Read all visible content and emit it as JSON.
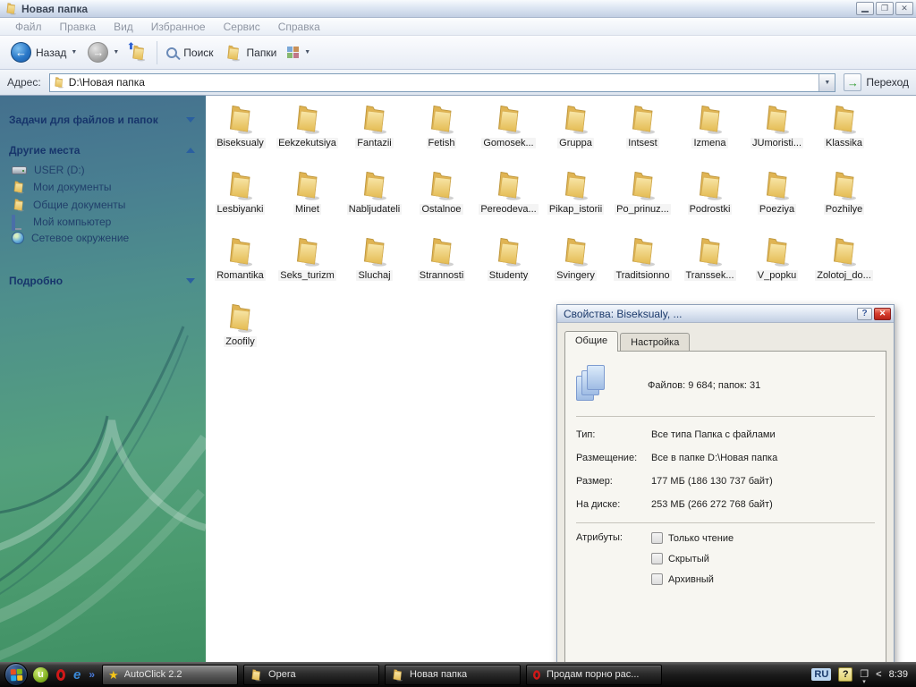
{
  "window": {
    "title": "Новая папка",
    "menu": [
      "Файл",
      "Правка",
      "Вид",
      "Избранное",
      "Сервис",
      "Справка"
    ],
    "toolbar": {
      "back_label": "Назад",
      "search_label": "Поиск",
      "folders_label": "Папки"
    },
    "address": {
      "label": "Адрес:",
      "value": "D:\\Новая папка",
      "go_label": "Переход"
    }
  },
  "sidebar": {
    "sections": [
      {
        "title": "Задачи для файлов и папок",
        "collapsed": true
      },
      {
        "title": "Другие места",
        "collapsed": false
      },
      {
        "title": "Подробно",
        "collapsed": true
      }
    ],
    "places": [
      {
        "label": "USER (D:)",
        "icon": "drive"
      },
      {
        "label": "Мои документы",
        "icon": "folder"
      },
      {
        "label": "Общие документы",
        "icon": "folder"
      },
      {
        "label": "Мой компьютер",
        "icon": "computer"
      },
      {
        "label": "Сетевое окружение",
        "icon": "network"
      }
    ]
  },
  "folders": [
    "Biseksualy",
    "Eekzekutsiya",
    "Fantazii",
    "Fetish",
    "Gomosek...",
    "Gruppa",
    "Intsest",
    "Izmena",
    "JUmoristi...",
    "Klassika",
    "Lesbiyanki",
    "Minet",
    "Nabljudateli",
    "Ostalnoe",
    "Pereodeva...",
    "Pikap_istorii",
    "Po_prinuz...",
    "Podrostki",
    "Poeziya",
    "Pozhilye",
    "Romantika",
    "Seks_turizm",
    "Sluchaj",
    "Strannosti",
    "Studenty",
    "Svingery",
    "Traditsionno",
    "Transsek...",
    "V_popku",
    "Zolotoj_do...",
    "Zoofily"
  ],
  "dialog": {
    "title": "Свойства: Biseksualy, ...",
    "tabs": [
      "Общие",
      "Настройка"
    ],
    "summary": "Файлов: 9 684; папок: 31",
    "rows": [
      {
        "label": "Тип:",
        "value": "Все типа Папка с файлами"
      },
      {
        "label": "Размещение:",
        "value": "Все в папке D:\\Новая папка"
      },
      {
        "label": "Размер:",
        "value": "177 МБ (186 130 737 байт)"
      },
      {
        "label": "На диске:",
        "value": "253 МБ (266 272 768 байт)"
      }
    ],
    "attributes": {
      "label": "Атрибуты:",
      "options": [
        {
          "label": "Только чтение",
          "checked": false
        },
        {
          "label": "Скрытый",
          "checked": false
        },
        {
          "label": "Архивный",
          "checked": false
        }
      ]
    }
  },
  "taskbar": {
    "buttons": [
      {
        "label": "AutoClick 2.2",
        "icon": "star",
        "active": true
      },
      {
        "label": "Opera",
        "icon": "folder",
        "active": false
      },
      {
        "label": "Новая папка",
        "icon": "folder",
        "active": false
      },
      {
        "label": "Продам порно рас...",
        "icon": "opera",
        "active": false
      }
    ],
    "tray": {
      "lang": "RU",
      "clock": "8:39"
    }
  },
  "colors": {
    "sidebar_top": "#44708e",
    "sidebar_bottom": "#3f8f63",
    "folder_yellow": "#eec86a",
    "dialog_close_red": "#d84030",
    "taskbar_bg": "#1c1c1c"
  }
}
